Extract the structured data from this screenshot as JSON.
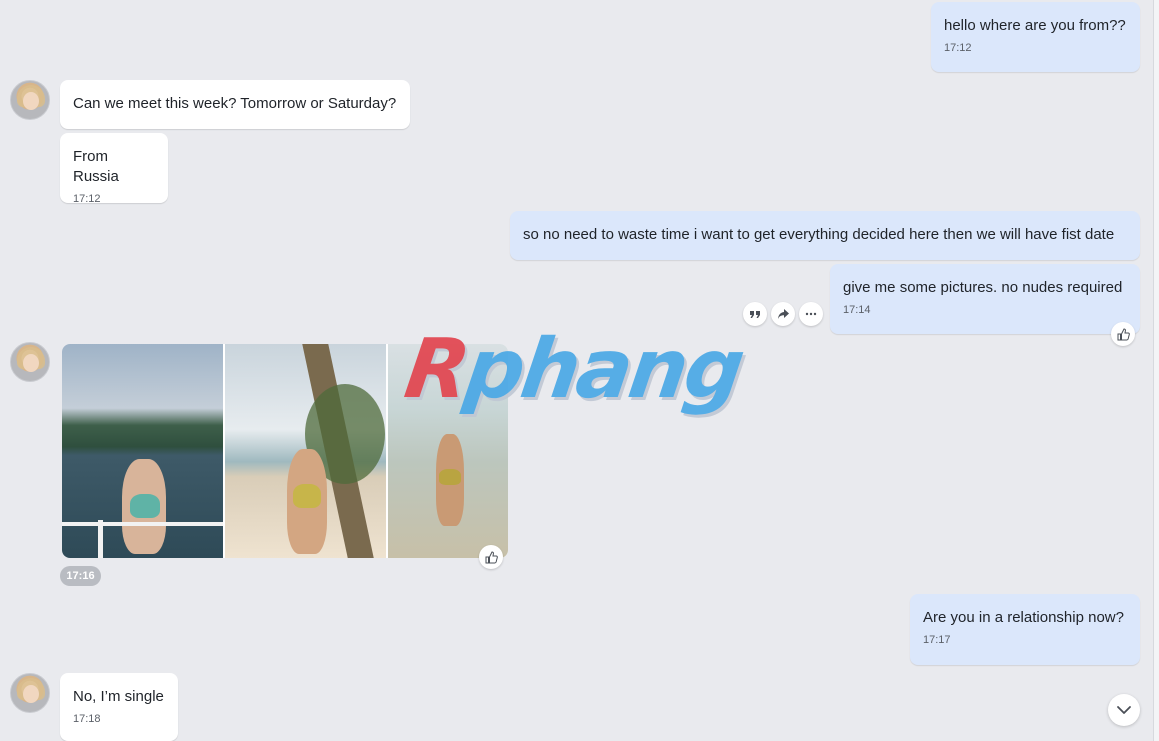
{
  "messages": {
    "m1": {
      "text": "hello where are you from??",
      "time": "17:12"
    },
    "m2": {
      "text": "Can we meet this week? Tomorrow or Saturday?"
    },
    "m3": {
      "text": "From Russia",
      "time": "17:12"
    },
    "m4": {
      "text": "so no need to waste time i want to get everything decided here then we will have fist date"
    },
    "m5": {
      "text": "give me some pictures. no nudes required",
      "time": "17:14"
    },
    "m6": {
      "time": "17:16"
    },
    "m7": {
      "text": "Are you in a relationship now?",
      "time": "17:17"
    },
    "m8": {
      "text": "No, I’m single",
      "time": "17:18"
    }
  },
  "watermark": {
    "text_a": "R",
    "text_b": "phang"
  },
  "icons": {
    "quote": "quote-icon",
    "forward": "forward-icon",
    "more": "more-icon",
    "like": "thumbs-up-icon",
    "scroll": "chevron-down-icon"
  },
  "colors": {
    "background": "#e9eaee",
    "incoming": "#ffffff",
    "outgoing": "#dbe7fb"
  }
}
